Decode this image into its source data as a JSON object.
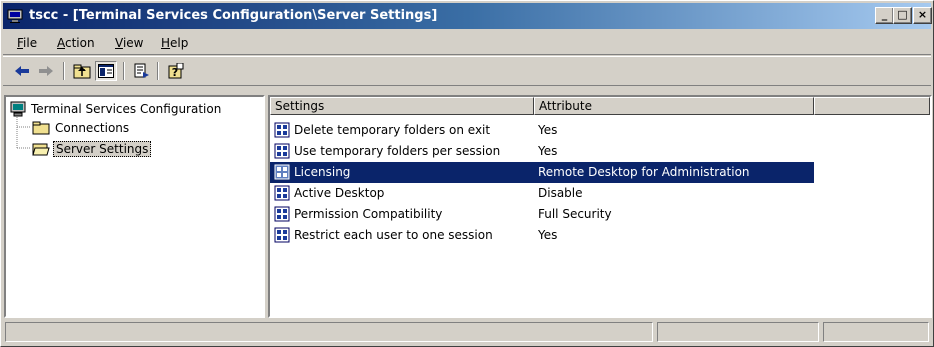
{
  "window": {
    "title": "tscc - [Terminal Services Configuration\\Server Settings]",
    "controls": {
      "minimize": "_",
      "maximize": "□",
      "close": "×"
    }
  },
  "menubar": {
    "items": [
      {
        "label": "File",
        "mnemonic": "F",
        "rest": "ile"
      },
      {
        "label": "Action",
        "mnemonic": "A",
        "rest": "ction"
      },
      {
        "label": "View",
        "mnemonic": "V",
        "rest": "iew"
      },
      {
        "label": "Help",
        "mnemonic": "H",
        "rest": "elp"
      }
    ]
  },
  "toolbar": {
    "buttons": [
      "back-arrow-icon",
      "forward-arrow-icon",
      "up-folder-icon",
      "show-hide-tree-icon",
      "export-list-icon",
      "help-icon"
    ]
  },
  "tree": {
    "root": "Terminal Services Configuration",
    "children": [
      {
        "label": "Connections",
        "selected": false
      },
      {
        "label": "Server Settings",
        "selected": true
      }
    ]
  },
  "list": {
    "columns": [
      "Settings",
      "Attribute"
    ],
    "rows": [
      {
        "setting": "Delete temporary folders on exit",
        "attribute": "Yes",
        "selected": false
      },
      {
        "setting": "Use temporary folders per session",
        "attribute": "Yes",
        "selected": false
      },
      {
        "setting": "Licensing",
        "attribute": "Remote Desktop for Administration",
        "selected": true
      },
      {
        "setting": "Active Desktop",
        "attribute": "Disable",
        "selected": false
      },
      {
        "setting": "Permission Compatibility",
        "attribute": "Full Security",
        "selected": false
      },
      {
        "setting": "Restrict each user to one session",
        "attribute": "Yes",
        "selected": false
      }
    ]
  },
  "colors": {
    "title_start": "#0a246a",
    "title_end": "#a6caf0",
    "selection": "#0a246a",
    "face": "#d4d0c8"
  }
}
